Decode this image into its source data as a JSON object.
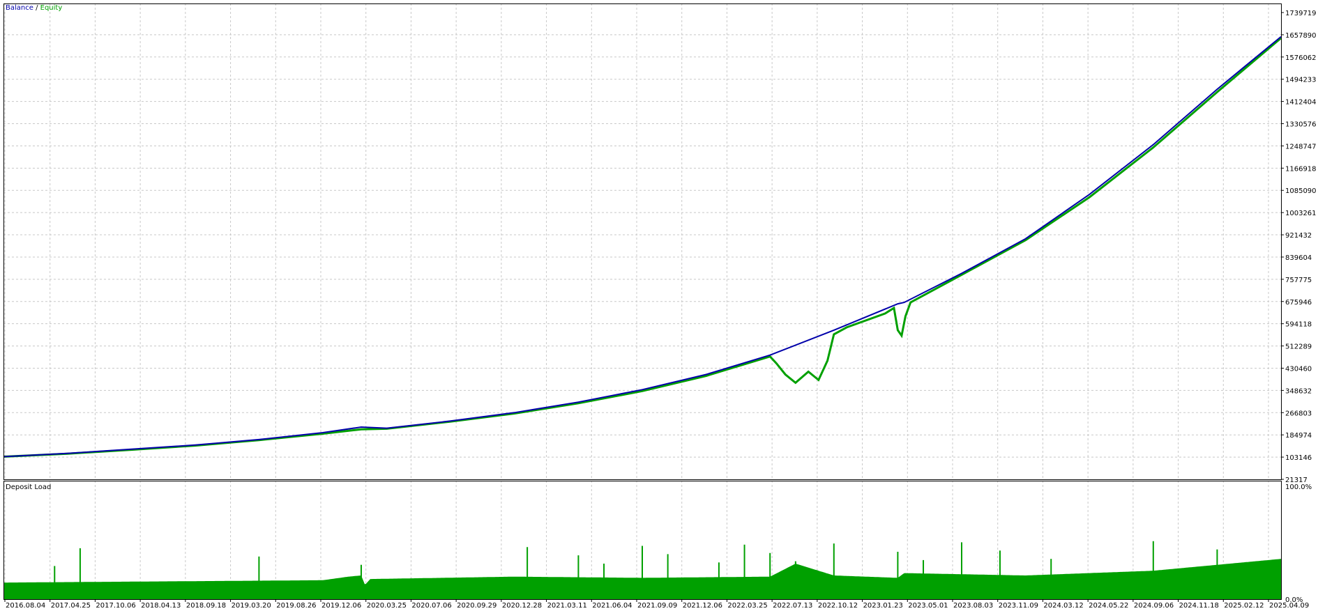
{
  "legend": {
    "balance_label": "Balance",
    "separator": " / ",
    "equity_label": "Equity",
    "balance_color": "#0000aa",
    "equity_color": "#00a000"
  },
  "subpane": {
    "title": "Deposit Load",
    "top_label": "100.0%",
    "bottom_label": "0.0%"
  },
  "chart_data": [
    {
      "type": "line",
      "title": "",
      "series": [
        {
          "name": "Balance",
          "color": "#0000aa",
          "points": [
            [
              0,
              103146
            ],
            [
              0.05,
              115000
            ],
            [
              0.1,
              130000
            ],
            [
              0.15,
              145000
            ],
            [
              0.2,
              165000
            ],
            [
              0.25,
              190000
            ],
            [
              0.28,
              210000
            ],
            [
              0.3,
              206000
            ],
            [
              0.35,
              232000
            ],
            [
              0.4,
              262000
            ],
            [
              0.45,
              300000
            ],
            [
              0.5,
              345000
            ],
            [
              0.55,
              400000
            ],
            [
              0.6,
              470000
            ],
            [
              0.65,
              560000
            ],
            [
              0.7,
              655000
            ],
            [
              0.703,
              658000
            ],
            [
              0.705,
              660000
            ],
            [
              0.75,
              765000
            ],
            [
              0.8,
              890000
            ],
            [
              0.85,
              1050000
            ],
            [
              0.9,
              1230000
            ],
            [
              0.95,
              1430000
            ],
            [
              1.0,
              1620000
            ]
          ]
        },
        {
          "name": "Equity",
          "color": "#00a000",
          "points": [
            [
              0,
              103146
            ],
            [
              0.05,
              114000
            ],
            [
              0.1,
              128000
            ],
            [
              0.15,
              143000
            ],
            [
              0.2,
              163000
            ],
            [
              0.25,
              186000
            ],
            [
              0.28,
              202000
            ],
            [
              0.3,
              204000
            ],
            [
              0.35,
              230000
            ],
            [
              0.4,
              259000
            ],
            [
              0.45,
              296000
            ],
            [
              0.5,
              340000
            ],
            [
              0.55,
              395000
            ],
            [
              0.6,
              465000
            ],
            [
              0.605,
              440000
            ],
            [
              0.612,
              400000
            ],
            [
              0.62,
              370000
            ],
            [
              0.63,
              410000
            ],
            [
              0.638,
              380000
            ],
            [
              0.645,
              450000
            ],
            [
              0.65,
              545000
            ],
            [
              0.66,
              570000
            ],
            [
              0.69,
              620000
            ],
            [
              0.697,
              640000
            ],
            [
              0.7,
              560000
            ],
            [
              0.703,
              540000
            ],
            [
              0.706,
              610000
            ],
            [
              0.71,
              660000
            ],
            [
              0.75,
              760000
            ],
            [
              0.8,
              885000
            ],
            [
              0.85,
              1040000
            ],
            [
              0.9,
              1220000
            ],
            [
              0.95,
              1420000
            ],
            [
              1.0,
              1615000
            ]
          ]
        }
      ],
      "y_tick_labels": [
        "1739719",
        "1657890",
        "1576062",
        "1494233",
        "1412404",
        "1330576",
        "1248747",
        "1166918",
        "1085090",
        "1003261",
        "921432",
        "839604",
        "757775",
        "675946",
        "594118",
        "512289",
        "430460",
        "348632",
        "266803",
        "184974",
        "103146",
        "21317"
      ],
      "x_tick_labels": [
        "2016.08.04",
        "2017.04.25",
        "2017.10.06",
        "2018.04.13",
        "2018.09.18",
        "2019.03.20",
        "2019.08.26",
        "2019.12.06",
        "2020.03.25",
        "2020.07.06",
        "2020.09.29",
        "2020.12.28",
        "2021.03.11",
        "2021.06.04",
        "2021.09.09",
        "2021.12.06",
        "2022.03.25",
        "2022.07.13",
        "2022.10.12",
        "2023.01.23",
        "2023.05.01",
        "2023.08.03",
        "2023.11.09",
        "2024.03.12",
        "2024.05.22",
        "2024.09.06",
        "2024.11.18",
        "2025.02.12",
        "2025.04.09"
      ],
      "ylim": [
        21317,
        1739719
      ],
      "grid": true,
      "legend_position": "top-left"
    },
    {
      "type": "bar",
      "title": "Deposit Load",
      "y_tick_labels": [
        "100.0%",
        "0.0%"
      ],
      "ylim": [
        0,
        100
      ],
      "bar_color": "#00a000",
      "baseline_profile": [
        [
          0,
          14
        ],
        [
          0.25,
          16
        ],
        [
          0.27,
          19
        ],
        [
          0.28,
          20
        ],
        [
          0.283,
          12
        ],
        [
          0.287,
          17
        ],
        [
          0.4,
          19
        ],
        [
          0.5,
          18
        ],
        [
          0.6,
          19
        ],
        [
          0.62,
          30
        ],
        [
          0.65,
          20
        ],
        [
          0.7,
          18
        ],
        [
          0.705,
          22
        ],
        [
          0.8,
          20
        ],
        [
          0.9,
          24
        ],
        [
          1.0,
          34
        ]
      ],
      "spikes": [
        [
          0.04,
          0
        ],
        [
          0.06,
          0
        ],
        [
          0.2,
          0
        ],
        [
          0.28,
          0
        ],
        [
          0.41,
          0
        ],
        [
          0.45,
          0
        ],
        [
          0.47,
          0
        ],
        [
          0.5,
          0
        ],
        [
          0.52,
          0
        ],
        [
          0.56,
          0
        ],
        [
          0.58,
          0
        ],
        [
          0.6,
          0
        ],
        [
          0.62,
          0
        ],
        [
          0.65,
          0
        ],
        [
          0.7,
          0
        ],
        [
          0.72,
          0
        ],
        [
          0.75,
          0
        ],
        [
          0.78,
          0
        ],
        [
          0.82,
          0
        ],
        [
          0.9,
          0
        ],
        [
          0.95,
          0
        ]
      ]
    }
  ]
}
